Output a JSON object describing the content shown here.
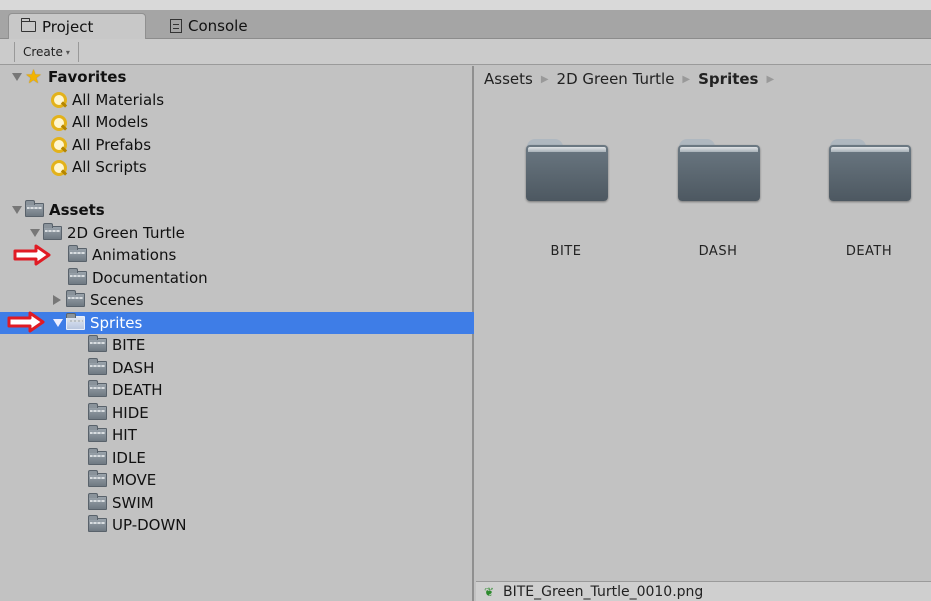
{
  "tabs": [
    {
      "label": "Project",
      "icon": "folder-icon"
    },
    {
      "label": "Console",
      "icon": "console-icon"
    }
  ],
  "toolbar": {
    "create_label": "Create"
  },
  "tree": {
    "favorites_label": "Favorites",
    "favorites": [
      "All Materials",
      "All Models",
      "All Prefabs",
      "All Scripts"
    ],
    "assets_label": "Assets",
    "green_turtle_label": "2D Green Turtle",
    "animations_label": "Animations",
    "documentation_label": "Documentation",
    "scenes_label": "Scenes",
    "sprites_label": "Sprites",
    "sprite_folders": [
      "BITE",
      "DASH",
      "DEATH",
      "HIDE",
      "HIT",
      "IDLE",
      "MOVE",
      "SWIM",
      "UP-DOWN"
    ]
  },
  "breadcrumb": [
    "Assets",
    "2D Green Turtle",
    "Sprites"
  ],
  "grid_folders": [
    "BITE",
    "DASH",
    "DEATH"
  ],
  "status": {
    "filename": "BITE_Green_Turtle_0010.png"
  },
  "colors": {
    "selection": "#3e7de7",
    "arrow": "#e01b24",
    "panel": "#c2c2c2"
  }
}
